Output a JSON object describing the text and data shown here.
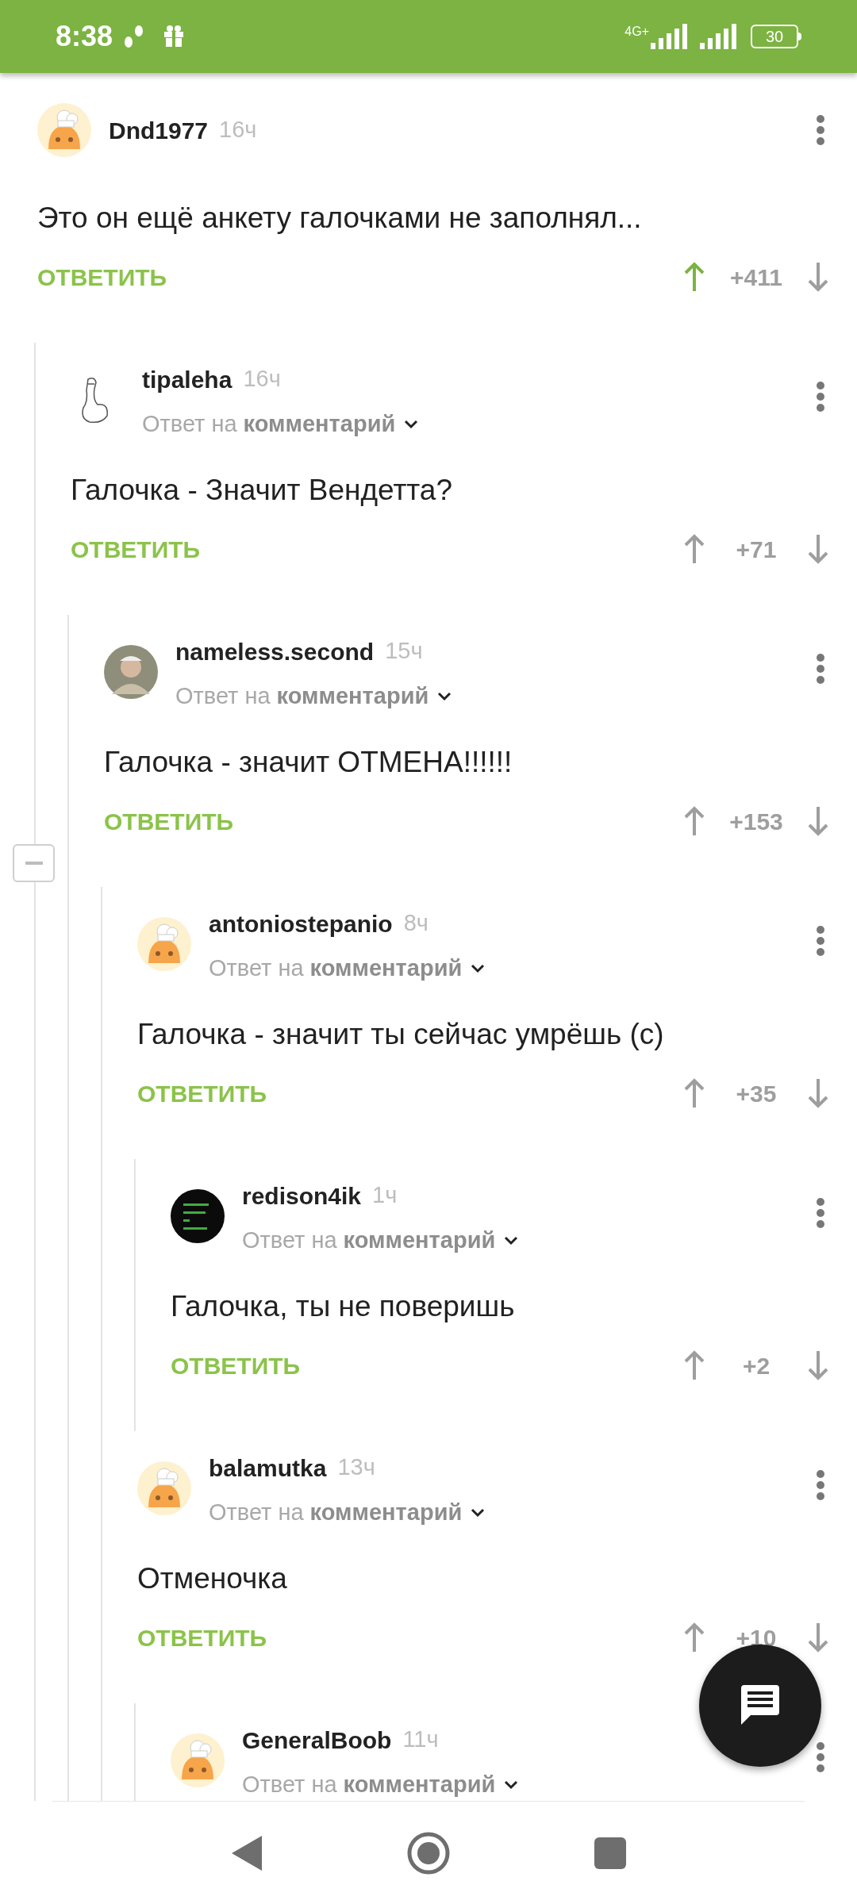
{
  "status_bar": {
    "time": "8:38",
    "network": "4G+",
    "battery": "30"
  },
  "comments": [
    {
      "author": "Dnd1977",
      "time": "16ч",
      "avatar": {
        "kind": "chef"
      },
      "text": "Это он ещё анкету галочками не заполнял...",
      "reply": "ОТВЕТИТЬ",
      "score": "+411",
      "voted_up": true,
      "children": [
        {
          "author": "tipaleha",
          "time": "16ч",
          "avatar": {
            "kind": "sketch"
          },
          "reply_to": {
            "prefix": "Ответ на",
            "link": "комментарий"
          },
          "text": "Галочка - Значит Вендетта?",
          "reply": "ОТВЕТИТЬ",
          "score": "+71",
          "voted_up": false,
          "children": [
            {
              "author": "nameless.second",
              "time": "15ч",
              "avatar": {
                "kind": "photo"
              },
              "reply_to": {
                "prefix": "Ответ на",
                "link": "комментарий"
              },
              "text": "Галочка - значит ОТМЕНА!!!!!!",
              "reply": "ОТВЕТИТЬ",
              "score": "+153",
              "voted_up": false,
              "expanded": true,
              "children": [
                {
                  "author": "antoniostepanio",
                  "time": "8ч",
                  "avatar": {
                    "kind": "chef"
                  },
                  "reply_to": {
                    "prefix": "Ответ на",
                    "link": "комментарий"
                  },
                  "text": "Галочка - значит ты сейчас умрёшь (с)",
                  "reply": "ОТВЕТИТЬ",
                  "score": "+35",
                  "voted_up": false,
                  "children": [
                    {
                      "author": "redison4ik",
                      "time": "1ч",
                      "avatar": {
                        "kind": "matrix"
                      },
                      "reply_to": {
                        "prefix": "Ответ на",
                        "link": "комментарий"
                      },
                      "text": "Галочка, ты не поверишь",
                      "reply": "ОТВЕТИТЬ",
                      "score": "+2",
                      "voted_up": false
                    }
                  ]
                },
                {
                  "author": "balamutka",
                  "time": "13ч",
                  "avatar": {
                    "kind": "chef"
                  },
                  "reply_to": {
                    "prefix": "Ответ на",
                    "link": "комментарий"
                  },
                  "text": "Отменочка",
                  "reply": "ОТВЕТИТЬ",
                  "score": "+10",
                  "voted_up": false,
                  "children": [
                    {
                      "author": "GeneralBoob",
                      "time": "11ч",
                      "avatar": {
                        "kind": "chef"
                      },
                      "reply_to": {
                        "prefix": "Ответ на",
                        "link": "комментарий"
                      }
                    }
                  ]
                }
              ]
            }
          ]
        }
      ]
    }
  ]
}
